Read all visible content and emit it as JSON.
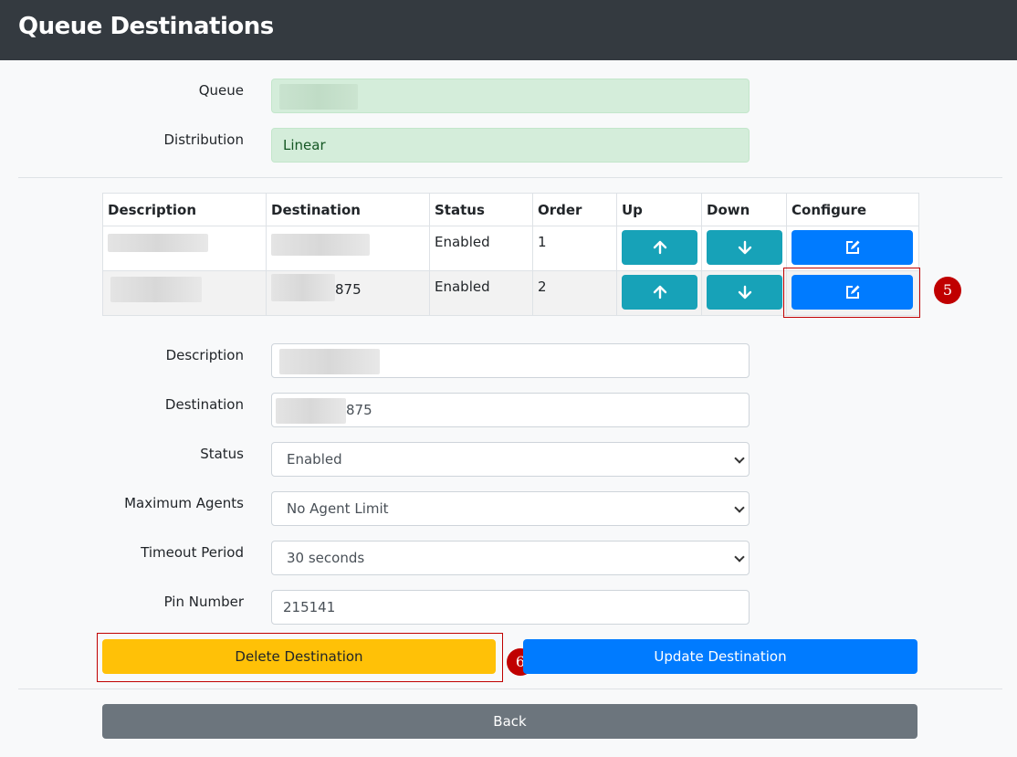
{
  "page": {
    "title": "Queue Destinations"
  },
  "queue_form": {
    "queue_label": "Queue",
    "queue_value": "",
    "distribution_label": "Distribution",
    "distribution_value": "Linear"
  },
  "table": {
    "headers": [
      "Description",
      "Destination",
      "Status",
      "Order",
      "Up",
      "Down",
      "Configure"
    ],
    "rows": [
      {
        "description": "",
        "destination": "",
        "status": "Enabled",
        "order": "1"
      },
      {
        "description": "",
        "destination": "875",
        "status": "Enabled",
        "order": "2"
      }
    ]
  },
  "edit_form": {
    "description_label": "Description",
    "description_value": "",
    "destination_label": "Destination",
    "destination_value": "875",
    "status_label": "Status",
    "status_value": "Enabled",
    "max_agents_label": "Maximum Agents",
    "max_agents_value": "No Agent Limit",
    "timeout_label": "Timeout Period",
    "timeout_value": "30 seconds",
    "pin_label": "Pin Number",
    "pin_value": "215141"
  },
  "buttons": {
    "delete": "Delete Destination",
    "update": "Update Destination",
    "back": "Back"
  },
  "annotations": {
    "configure_marker": "5",
    "delete_marker": "6"
  },
  "icons": {
    "up": "arrow-up-icon",
    "down": "arrow-down-icon",
    "configure": "edit-icon"
  },
  "colors": {
    "header_bg": "#343a40",
    "teal": "#17a2b8",
    "primary": "#007bff",
    "warning": "#ffc107",
    "secondary": "#6c757d",
    "callout": "#c00000"
  }
}
